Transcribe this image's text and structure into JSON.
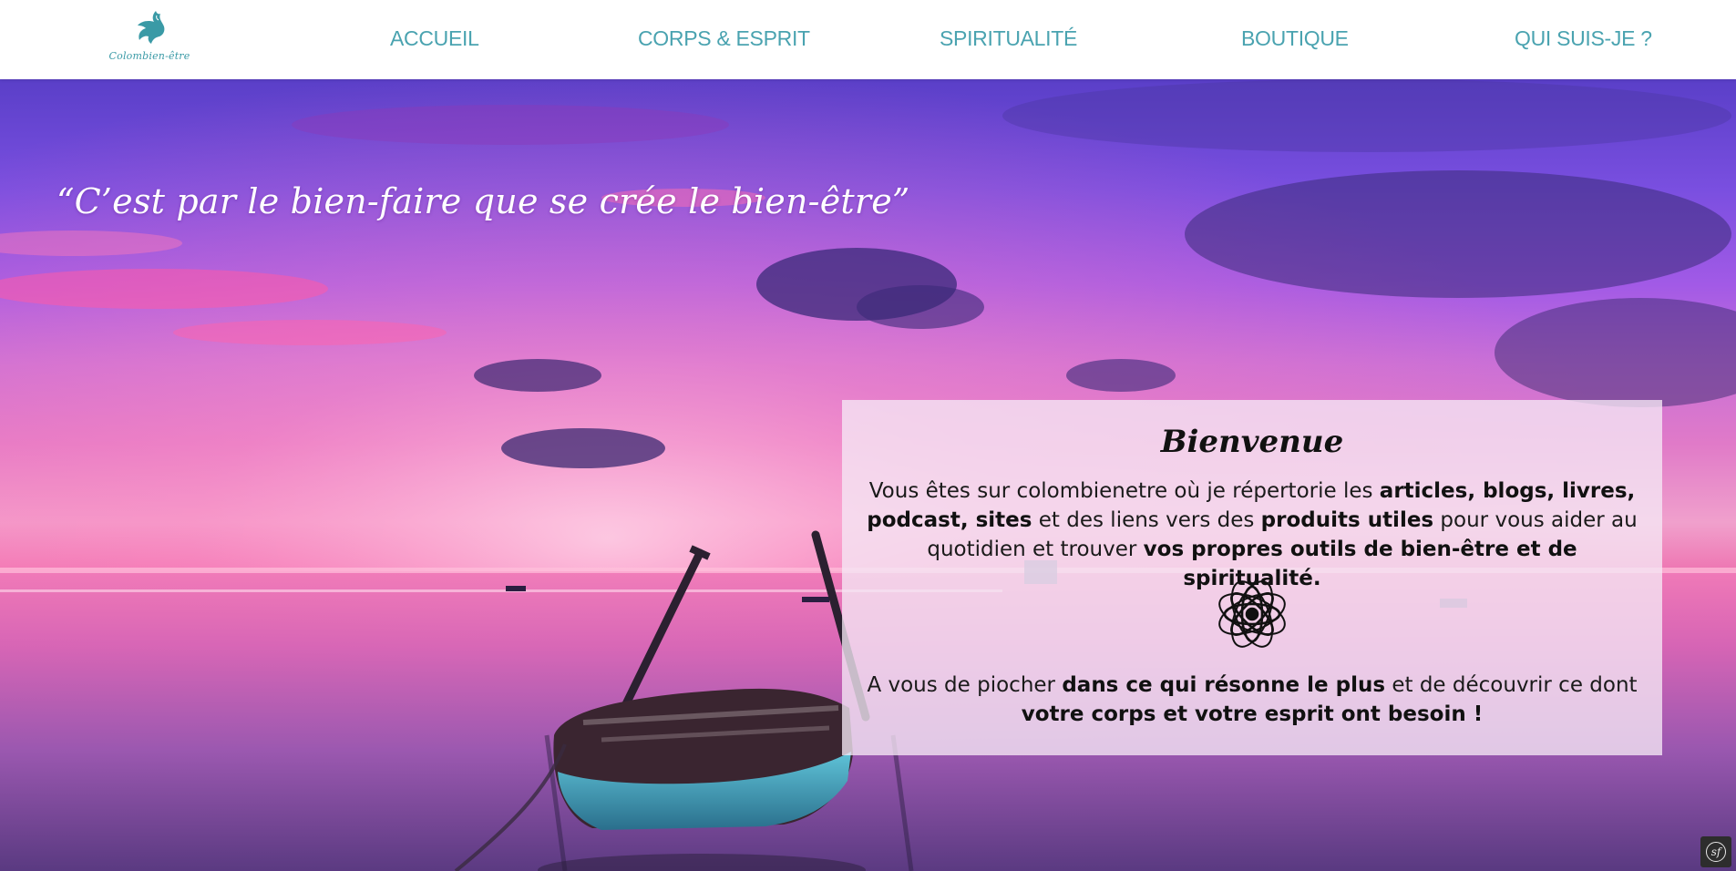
{
  "header": {
    "logo_text": "Colombien-être",
    "nav": [
      {
        "label": "ACCUEIL"
      },
      {
        "label": "CORPS & ESPRIT"
      },
      {
        "label": "SPIRITUALITÉ"
      },
      {
        "label": "BOUTIQUE"
      },
      {
        "label": "QUI SUIS-JE ?"
      }
    ]
  },
  "hero": {
    "quote": "“C’est par le bien-faire que se crée le bien-être”",
    "background": "sunset-over-sea-with-wooden-boat"
  },
  "welcome": {
    "title": "Bienvenue",
    "p1": {
      "t1": "Vous êtes sur colombienetre où je répertorie les ",
      "b1": "articles, blogs, livres, podcast, sites",
      "t2": " et des liens vers des ",
      "b2": "produits utiles",
      "t3": " pour vous aider au quotidien et trouver ",
      "b3": "vos propres outils de bien-être et de spiritualité."
    },
    "icon": "mandala-flower-icon",
    "p2": {
      "t1": "A vous de piocher ",
      "b1": "dans ce qui résonne le plus",
      "t2": " et de découvrir ce dont ",
      "b2": "votre corps et votre esprit ont besoin !"
    }
  },
  "debug_badge": {
    "label": "sf"
  },
  "colors": {
    "nav_text": "#4aa3b0",
    "logo": "#3a9aa6",
    "card_bg": "rgba(245,232,245,0.78)"
  }
}
